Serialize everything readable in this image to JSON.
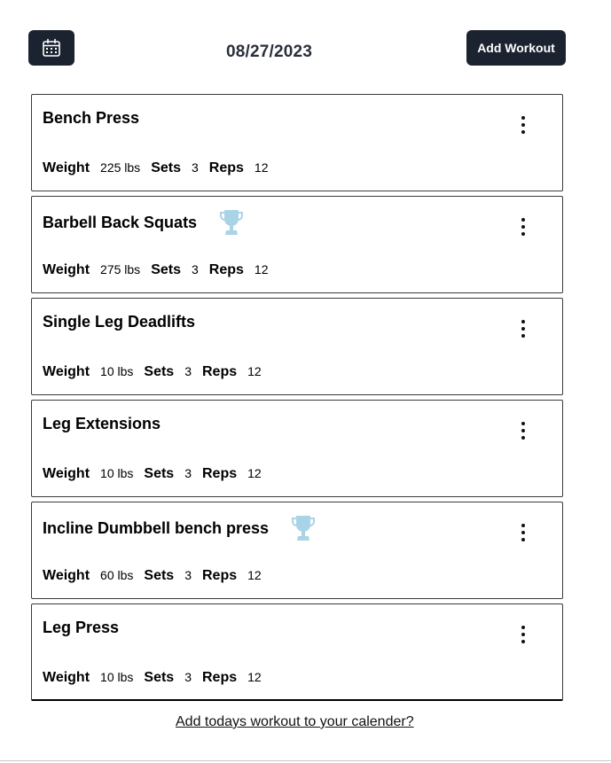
{
  "header": {
    "date": "08/27/2023",
    "add_workout_label": "Add Workout"
  },
  "labels": {
    "weight": "Weight",
    "sets": "Sets",
    "reps": "Reps"
  },
  "workouts": [
    {
      "name": "Bench Press",
      "weight": "225 lbs",
      "sets": "3",
      "reps": "12",
      "trophy": false
    },
    {
      "name": "Barbell Back Squats",
      "weight": "275 lbs",
      "sets": "3",
      "reps": "12",
      "trophy": true
    },
    {
      "name": "Single Leg Deadlifts",
      "weight": "10 lbs",
      "sets": "3",
      "reps": "12",
      "trophy": false
    },
    {
      "name": "Leg Extensions",
      "weight": "10 lbs",
      "sets": "3",
      "reps": "12",
      "trophy": false
    },
    {
      "name": "Incline Dumbbell bench press",
      "weight": "60 lbs",
      "sets": "3",
      "reps": "12",
      "trophy": true
    },
    {
      "name": "Leg Press",
      "weight": "10 lbs",
      "sets": "3",
      "reps": "12",
      "trophy": false
    }
  ],
  "footer": {
    "calendar_link": "Add todays workout to your calender?"
  },
  "colors": {
    "button_bg": "#1c2330",
    "trophy": "#a8d4e6"
  }
}
